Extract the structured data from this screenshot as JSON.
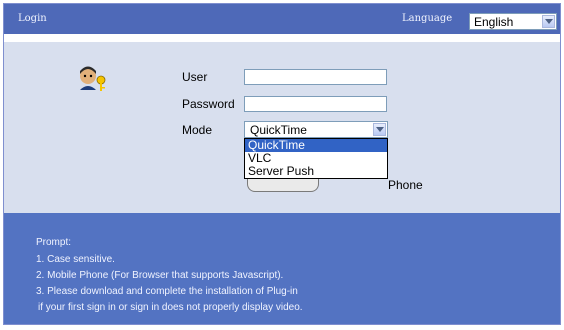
{
  "header": {
    "title": "Login",
    "language_label": "Language",
    "language_value": "English"
  },
  "form": {
    "user_label": "User",
    "user_value": "",
    "password_label": "Password",
    "password_value": "",
    "mode_label": "Mode",
    "mode_value": "QuickTime",
    "mode_options": [
      "QuickTime",
      "VLC",
      "Server Push"
    ],
    "mode_selected_index": 0,
    "phone_text": "Phone"
  },
  "prompt": {
    "title": "Prompt:",
    "lines": [
      "1. Case sensitive.",
      "2. Mobile Phone (For Browser that supports Javascript).",
      "3. Please download and complete the installation of Plug-in",
      " if your first sign in or sign in does not properly display video."
    ]
  },
  "colors": {
    "header_bg": "#4e69b8",
    "form_bg": "#d8dfee",
    "footer_bg": "#5373c2",
    "highlight": "#3163c5"
  },
  "icons": [
    "login-user-key-icon",
    "chevron-down-icon"
  ]
}
